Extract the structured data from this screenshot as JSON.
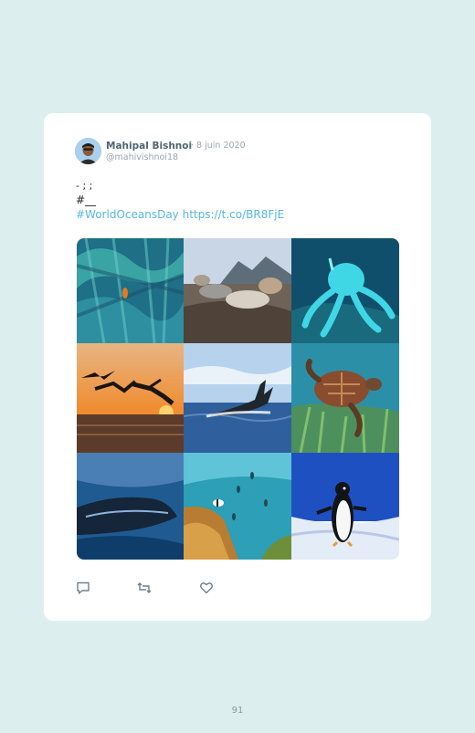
{
  "tweet": {
    "author_name": "Mahipal Bishnoi",
    "date": "· 8 juin 2020",
    "handle": "@mahivishnoi18",
    "line1": "- ; ;",
    "line2": "#__",
    "hashtag": "#WorldOceansDay",
    "link": "https://t.co/BR8FjE"
  },
  "icons": {
    "reply": "reply-icon",
    "retweet": "retweet-icon",
    "like": "heart-icon"
  },
  "page_number": "91",
  "colors": {
    "background": "#dcefee",
    "card": "#ffffff",
    "link": "#55b7e6",
    "name": "#4f6573",
    "muted": "#9aa7b1"
  }
}
